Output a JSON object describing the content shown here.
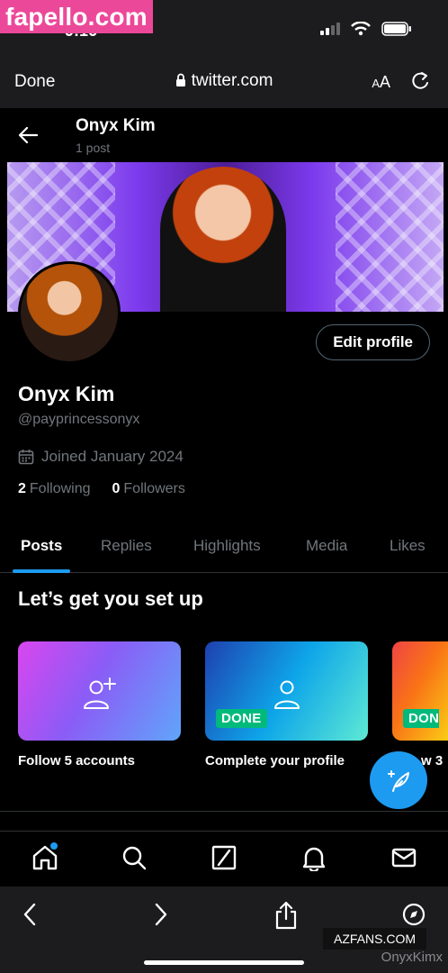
{
  "watermarks": {
    "top_left": "fapello.com",
    "bottom_box": "AZFANS.COM",
    "bottom_text": "OnyxKimx"
  },
  "status": {
    "time": "9:16"
  },
  "browser": {
    "done_label": "Done",
    "url": "twitter.com",
    "text_size_label_small": "A",
    "text_size_label_large": "A"
  },
  "profile_header": {
    "name": "Onyx Kim",
    "post_count": "1 post"
  },
  "profile": {
    "edit_button": "Edit profile",
    "name": "Onyx Kim",
    "handle": "@payprincessonyx",
    "joined": "Joined January 2024",
    "following_count": "2",
    "following_label": "Following",
    "followers_count": "0",
    "followers_label": "Followers"
  },
  "tabs": [
    {
      "label": "Posts",
      "active": true
    },
    {
      "label": "Replies",
      "active": false
    },
    {
      "label": "Highlights",
      "active": false
    },
    {
      "label": "Media",
      "active": false
    },
    {
      "label": "Likes",
      "active": false
    }
  ],
  "setup": {
    "title": "Let’s get you set up",
    "cards": [
      {
        "label": "Follow 5 accounts",
        "badge": "",
        "icon": "add-person-icon"
      },
      {
        "label": "Complete your profile",
        "badge": "DONE",
        "icon": "person-icon"
      },
      {
        "label": "w 3",
        "badge": "DON",
        "icon": ""
      }
    ]
  },
  "colors": {
    "accent": "#1d9bf0",
    "done_green": "#00ba7c",
    "muted": "#71767b"
  }
}
